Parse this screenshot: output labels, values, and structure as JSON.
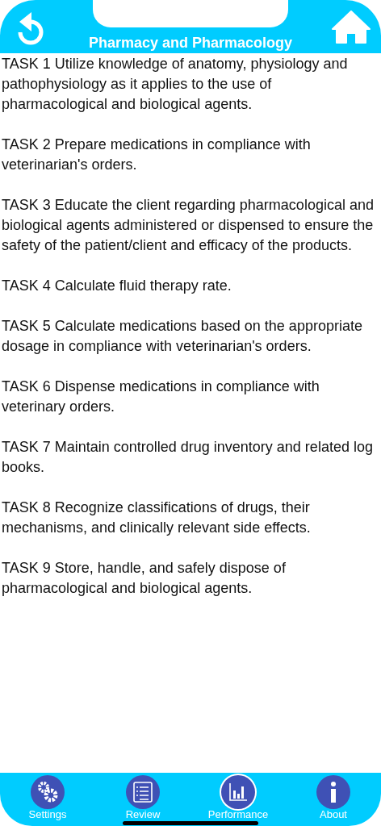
{
  "header": {
    "title": "Pharmacy and Pharmacology"
  },
  "tasks": [
    "TASK 1 Utilize knowledge of anatomy, physiology and pathophysiology as it applies to the use of pharmacological and biological agents.",
    "TASK 2 Prepare medications in compliance with veterinarian's orders.",
    "TASK 3 Educate the client regarding pharmacological and biological agents administered or dispensed to ensure the safety of the patient/client and efficacy of the products.",
    "TASK 4 Calculate fluid therapy rate.",
    "TASK 5 Calculate medications based on the appropriate dosage in compliance with veterinarian's orders.",
    "TASK 6 Dispense medications in compliance with veterinary orders.",
    "TASK 7 Maintain controlled drug inventory and related log books.",
    "TASK 8 Recognize classifications of drugs, their mechanisms, and clinically relevant side effects.",
    "TASK 9 Store, handle, and safely dispose of pharmacological and biological agents."
  ],
  "tabs": [
    {
      "kind": "settings",
      "label": "Settings",
      "selected": false
    },
    {
      "kind": "review",
      "label": "Review",
      "selected": false
    },
    {
      "kind": "performance",
      "label": "Performance",
      "selected": true
    },
    {
      "kind": "about",
      "label": "About",
      "selected": false
    }
  ]
}
